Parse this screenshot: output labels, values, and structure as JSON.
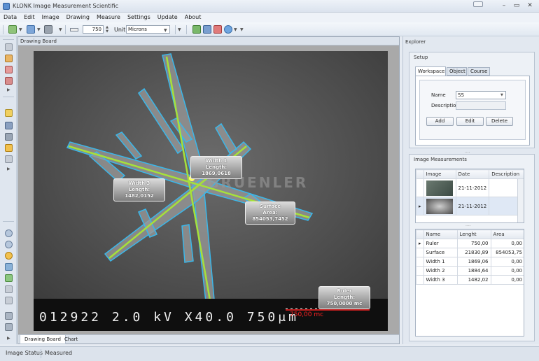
{
  "app": {
    "title": "KLONK Image Measurement Scientific"
  },
  "menu": [
    "Data",
    "Edit",
    "Image",
    "Drawing",
    "Measure",
    "Settings",
    "Update",
    "About"
  ],
  "toolbar": {
    "zoom_value": "750",
    "unit_label": "Unit",
    "unit_value": "Microns"
  },
  "drawing_board": {
    "header": "Drawing Board",
    "tabs": [
      "Drawing Board",
      "Chart"
    ],
    "watermark": "GRUENLER",
    "info_bar": "012922 2.0 kV X40.0 750μm",
    "ruler_red": "750,00 mc",
    "labels": {
      "width1": {
        "title": "Width 1",
        "value": "Length: 1869,0618"
      },
      "width3": {
        "title": "Width 3",
        "value": "Length: 1482,0152"
      },
      "surface": {
        "title": "Surface",
        "value": "Area: 854053,7452"
      },
      "ruler": {
        "title": "Ruler",
        "value": "Length: 750,0000 mc"
      }
    }
  },
  "explorer": {
    "title": "Explorer",
    "setup": {
      "title": "Setup",
      "tabs": [
        "Workspace",
        "Object",
        "Course"
      ],
      "name_label": "Name",
      "name_value": "SS",
      "description_label": "Description",
      "description_value": "",
      "buttons": [
        "Add",
        "Edit",
        "Delete"
      ]
    },
    "image_measurements": {
      "title": "Image Measurements",
      "image_columns": [
        "Image",
        "Date",
        "Description"
      ],
      "images": [
        {
          "date": "21-11-2012",
          "description": ""
        },
        {
          "date": "21-11-2012",
          "description": ""
        }
      ],
      "measure_columns": [
        "Name",
        "Lenght",
        "Area"
      ],
      "measurements": [
        {
          "name": "Ruler",
          "length": "750,00",
          "area": "0,00"
        },
        {
          "name": "Surface",
          "length": "21830,89",
          "area": "854053,75"
        },
        {
          "name": "Width 1",
          "length": "1869,06",
          "area": "0,00"
        },
        {
          "name": "Width 2",
          "length": "1884,64",
          "area": "0,00"
        },
        {
          "name": "Width 3",
          "length": "1482,02",
          "area": "0,00"
        }
      ]
    }
  },
  "status": {
    "left": "Image Status",
    "right": "Measured"
  },
  "colors": {
    "accent": "#4a7fc1",
    "measure_line": "#a6e13a",
    "outline": "#3ab7ea",
    "ruler_red": "#ff2222"
  }
}
